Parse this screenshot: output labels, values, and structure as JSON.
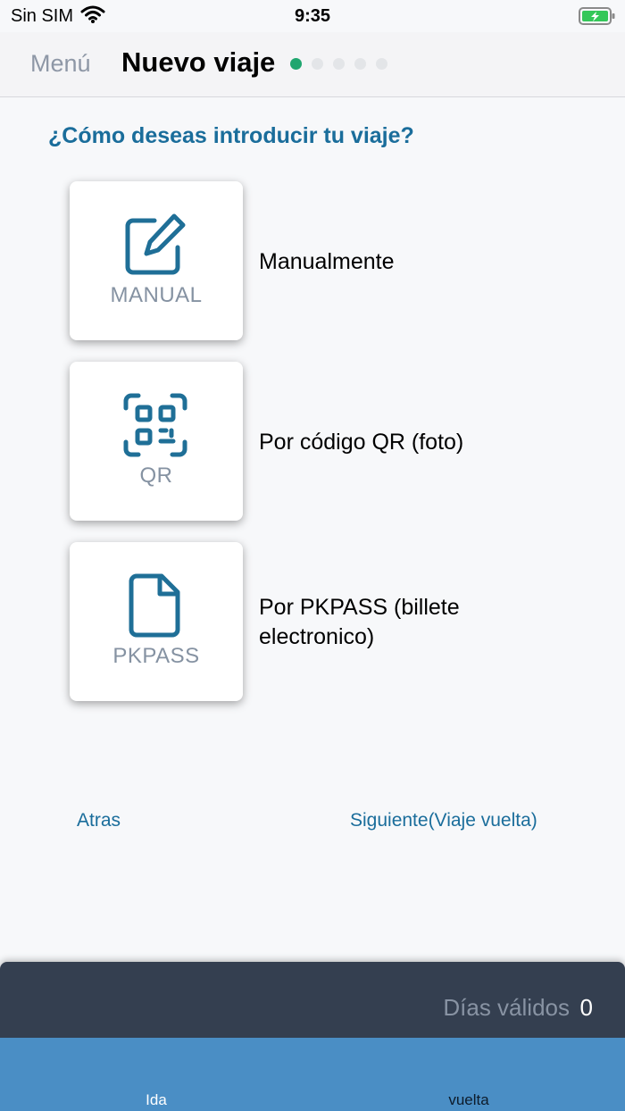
{
  "status_bar": {
    "carrier": "Sin SIM",
    "time": "9:35",
    "wifi_icon": "wifi-icon",
    "battery_icon": "battery-charging-icon",
    "battery_color": "#34c759"
  },
  "nav": {
    "menu_label": "Menú",
    "title": "Nuevo viaje",
    "steps_total": 5,
    "steps_current": 1,
    "active_step_color": "#1fa66f"
  },
  "question": "¿Cómo deseas introducir tu viaje?",
  "options": [
    {
      "card_label": "MANUAL",
      "description": "Manualmente",
      "icon": "edit-icon"
    },
    {
      "card_label": "QR",
      "description": "Por código QR (foto)",
      "icon": "qr-code-icon"
    },
    {
      "card_label": "PKPASS",
      "description": "Por PKPASS (billete electronico)",
      "icon": "file-icon"
    }
  ],
  "navigation": {
    "back_label": "Atras",
    "next_label": "Siguiente(Viaje vuelta)"
  },
  "bottom_panel": {
    "days_label": "Días válidos",
    "days_value": "0"
  },
  "tabs": [
    {
      "label": "Ida"
    },
    {
      "label": "vuelta"
    }
  ],
  "colors": {
    "accent": "#1a6d9b",
    "panel_bg": "#343f50",
    "tab_bar_bg": "#4a8ec5"
  }
}
